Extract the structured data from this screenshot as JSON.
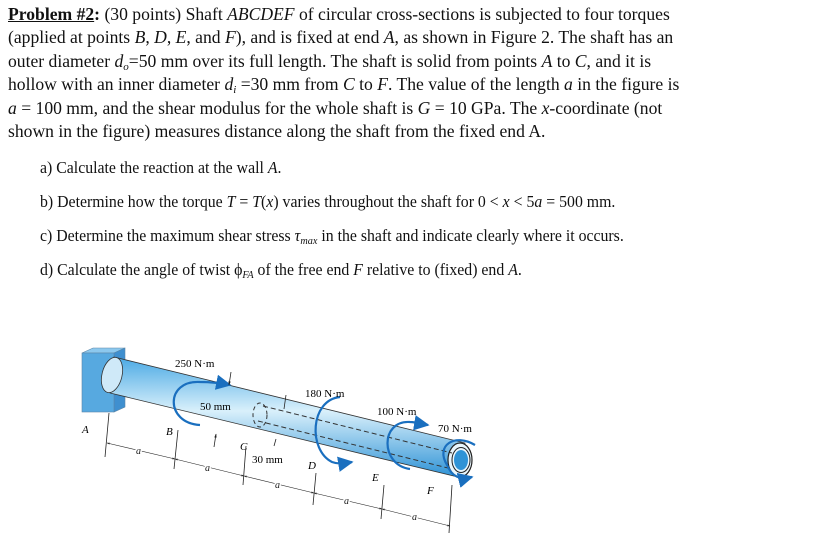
{
  "problem": {
    "heading": "Problem #2",
    "colon": ":",
    "points": "(30 points)",
    "lines": [
      [
        "Shaft ",
        "ABCDEF",
        " of circular cross-sections is subjected to four torques"
      ],
      [
        "(applied at points ",
        "B",
        ", ",
        "D",
        ", ",
        "E",
        ", and ",
        "F",
        "), and is fixed at end ",
        "A",
        ", as shown in Figure 2. The shaft has an"
      ],
      [
        "outer diameter ",
        "d",
        "o",
        "=50 mm over its full length.  The shaft is solid from points ",
        "A",
        " to ",
        "C",
        ", and it is"
      ],
      [
        "hollow with an inner diameter ",
        "d",
        "i",
        " =30 mm from ",
        "C",
        " to ",
        "F",
        ".  The value of the length ",
        "a",
        " in the figure is"
      ],
      [
        "a",
        " = 100 mm, and the shear modulus for the whole shaft is ",
        "G",
        " = 10 GPa.  The ",
        "x",
        "-coordinate (not"
      ],
      [
        "shown in the figure) measures distance along the shaft from the fixed end A."
      ]
    ]
  },
  "parts": [
    {
      "label": "a)",
      "segments": [
        "Calculate the reaction at the wall ",
        "A",
        "."
      ]
    },
    {
      "label": "b)",
      "segments": [
        "Determine how the torque ",
        "T",
        " = ",
        "T",
        "(",
        "x",
        ") varies throughout the shaft for 0 < ",
        "x",
        " < 5",
        "a",
        " = 500 mm."
      ]
    },
    {
      "label": "c)",
      "segments": [
        "Determine the maximum shear stress ",
        "τ",
        "max",
        " in the shaft and indicate clearly where it occurs."
      ]
    },
    {
      "label": "d)",
      "segments": [
        "Calculate the angle of twist ",
        "ϕ",
        "FA",
        " of the free end ",
        "F",
        " relative to (fixed) end ",
        "A",
        "."
      ]
    }
  ],
  "figure": {
    "torques": {
      "B": "250 N·m",
      "D": "180 N·m",
      "E": "100 N·m",
      "F": "70 N·m"
    },
    "dims": {
      "outer": "50 mm",
      "inner": "30 mm",
      "segment": "a"
    },
    "points": [
      "A",
      "B",
      "C",
      "D",
      "E",
      "F"
    ],
    "colors": {
      "shaft": "#3fa7e3",
      "shaft_light": "#d9f0fb",
      "wall": "#4a9fd8",
      "arrow": "#1a6fbf"
    }
  }
}
